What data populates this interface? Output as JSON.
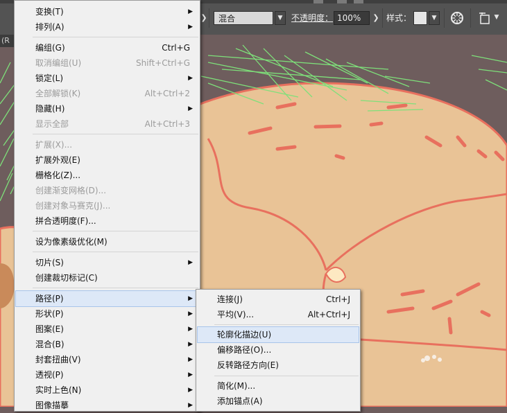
{
  "control_bar": {
    "blend_mode": "混合",
    "opacity_label": "不透明度：",
    "opacity_value": "100%",
    "style_label": "样式："
  },
  "doc_tab_fragment": "(R",
  "object_menu": {
    "items": [
      {
        "label": "变换(T)",
        "shortcut": "",
        "submenu": true,
        "disabled": false
      },
      {
        "label": "排列(A)",
        "shortcut": "",
        "submenu": true,
        "disabled": false
      },
      {
        "label": "编组(G)",
        "shortcut": "Ctrl+G",
        "submenu": false,
        "disabled": false
      },
      {
        "label": "取消编组(U)",
        "shortcut": "Shift+Ctrl+G",
        "submenu": false,
        "disabled": true
      },
      {
        "label": "锁定(L)",
        "shortcut": "",
        "submenu": true,
        "disabled": false
      },
      {
        "label": "全部解锁(K)",
        "shortcut": "Alt+Ctrl+2",
        "submenu": false,
        "disabled": true
      },
      {
        "label": "隐藏(H)",
        "shortcut": "",
        "submenu": true,
        "disabled": false
      },
      {
        "label": "显示全部",
        "shortcut": "Alt+Ctrl+3",
        "submenu": false,
        "disabled": true
      },
      {
        "label": "扩展(X)...",
        "shortcut": "",
        "submenu": false,
        "disabled": true
      },
      {
        "label": "扩展外观(E)",
        "shortcut": "",
        "submenu": false,
        "disabled": false
      },
      {
        "label": "栅格化(Z)...",
        "shortcut": "",
        "submenu": false,
        "disabled": false
      },
      {
        "label": "创建渐变网格(D)...",
        "shortcut": "",
        "submenu": false,
        "disabled": true
      },
      {
        "label": "创建对象马赛克(J)...",
        "shortcut": "",
        "submenu": false,
        "disabled": true
      },
      {
        "label": "拼合透明度(F)...",
        "shortcut": "",
        "submenu": false,
        "disabled": false
      },
      {
        "label": "设为像素级优化(M)",
        "shortcut": "",
        "submenu": false,
        "disabled": false
      },
      {
        "label": "切片(S)",
        "shortcut": "",
        "submenu": true,
        "disabled": false
      },
      {
        "label": "创建裁切标记(C)",
        "shortcut": "",
        "submenu": false,
        "disabled": false
      },
      {
        "label": "路径(P)",
        "shortcut": "",
        "submenu": true,
        "disabled": false,
        "highlighted": true
      },
      {
        "label": "形状(P)",
        "shortcut": "",
        "submenu": true,
        "disabled": false
      },
      {
        "label": "图案(E)",
        "shortcut": "",
        "submenu": true,
        "disabled": false
      },
      {
        "label": "混合(B)",
        "shortcut": "",
        "submenu": true,
        "disabled": false
      },
      {
        "label": "封套扭曲(V)",
        "shortcut": "",
        "submenu": true,
        "disabled": false
      },
      {
        "label": "透视(P)",
        "shortcut": "",
        "submenu": true,
        "disabled": false
      },
      {
        "label": "实时上色(N)",
        "shortcut": "",
        "submenu": true,
        "disabled": false
      },
      {
        "label": "图像描摹",
        "shortcut": "",
        "submenu": true,
        "disabled": false
      }
    ]
  },
  "path_submenu": {
    "items": [
      {
        "label": "连接(J)",
        "shortcut": "Ctrl+J",
        "disabled": false
      },
      {
        "label": "平均(V)...",
        "shortcut": "Alt+Ctrl+J",
        "disabled": false
      },
      {
        "label": "轮廓化描边(U)",
        "shortcut": "",
        "disabled": false,
        "highlighted": true
      },
      {
        "label": "偏移路径(O)...",
        "shortcut": "",
        "disabled": false
      },
      {
        "label": "反转路径方向(E)",
        "shortcut": "",
        "disabled": false
      },
      {
        "label": "简化(M)...",
        "shortcut": "",
        "disabled": false
      },
      {
        "label": "添加锚点(A)",
        "shortcut": "",
        "disabled": false
      }
    ]
  },
  "colors": {
    "menu_bg": "#f0f0f0",
    "highlight": "#dde8f7",
    "artwork_body": "#e9c396",
    "artwork_stroke": "#e8705e",
    "needle_green": "#7ee07a",
    "toolbar_bg": "#535353"
  }
}
